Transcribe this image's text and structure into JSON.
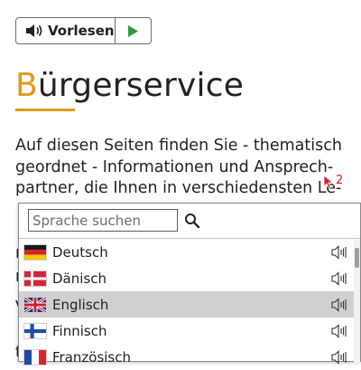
{
  "toolbar": {
    "read_label": "Vorlesen",
    "speaker_icon": "speaker-icon",
    "play_icon": "play-icon",
    "accent_color": "#2e9b3f"
  },
  "heading": {
    "first_letter": "B",
    "rest": "ürgerservice",
    "accent_color": "#e49a1c"
  },
  "intro": {
    "lines": [
      "Auf diesen Seiten finden Sie - thematisch",
      "geordnet - Informationen und Ansprech-",
      "partner, die Ihnen in verschiedensten Le-"
    ]
  },
  "cursor": {
    "badge": "2",
    "icon": "cursor-arrow-icon"
  },
  "language_panel": {
    "search_placeholder": "Sprache suchen",
    "search_icon": "search-icon",
    "languages": [
      {
        "name": "Deutsch",
        "flag": "de-flag-icon",
        "selected": false
      },
      {
        "name": "Dänisch",
        "flag": "dk-flag-icon",
        "selected": false
      },
      {
        "name": "Englisch",
        "flag": "gb-flag-icon",
        "selected": true
      },
      {
        "name": "Finnisch",
        "flag": "fi-flag-icon",
        "selected": false
      },
      {
        "name": "Französisch",
        "flag": "fr-flag-icon",
        "selected": false
      }
    ],
    "speak_icon": "speaker-outline-icon"
  },
  "background_fragments": {
    "letters": [
      "r",
      "r",
      "V",
      "t"
    ]
  }
}
